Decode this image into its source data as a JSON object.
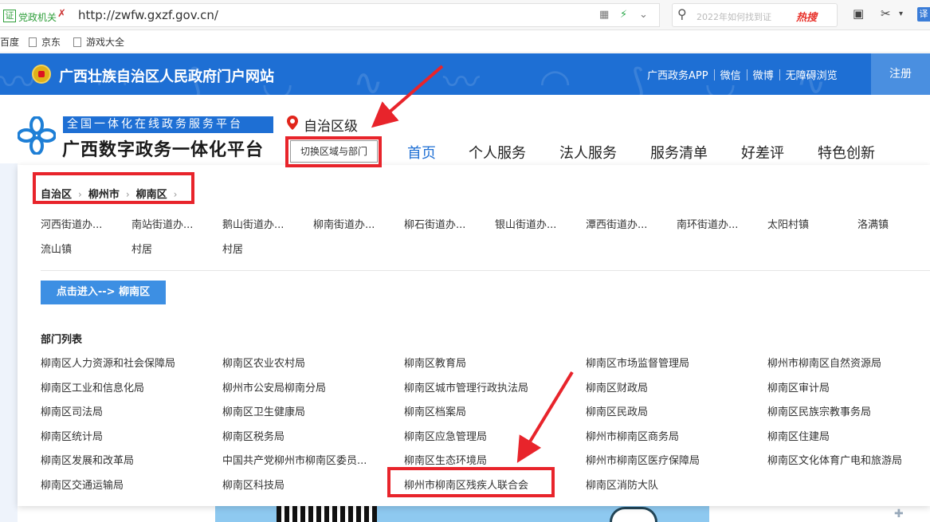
{
  "browser": {
    "cert_glyph": "证",
    "cert_label": "党政机关",
    "cert_mark": "✗",
    "url": "http://zwfw.gxzf.gov.cn/",
    "search_placeholder": "2022年如何找到证",
    "search_hot": "热搜",
    "translate_label": "译",
    "bookmarks": [
      "百度",
      "京东",
      "游戏大全"
    ]
  },
  "site": {
    "title": "广西壮族自治区人民政府门户网站",
    "links": [
      "广西政务APP",
      "微信",
      "微博",
      "无障碍浏览"
    ],
    "register": "注册",
    "brand_color": "#1e6fd4"
  },
  "platform": {
    "tagline": "全国一体化在线政务服务平台",
    "name": "广西数字政务一体化平台",
    "region": "自治区级",
    "switch_label": "切换区域与部门"
  },
  "nav": [
    "首页",
    "个人服务",
    "法人服务",
    "服务清单",
    "好差评",
    "特色创新"
  ],
  "panel": {
    "breadcrumb": [
      "自治区",
      "柳州市",
      "柳南区"
    ],
    "towns": [
      "河西街道办...",
      "南站街道办...",
      "鹅山街道办...",
      "柳南街道办...",
      "柳石街道办...",
      "银山街道办...",
      "潭西街道办...",
      "南环街道办...",
      "太阳村镇",
      "洛满镇",
      "流山镇",
      "村居",
      "村居"
    ],
    "enter_label": "点击进入--> 柳南区",
    "dept_title": "部门列表",
    "departments": [
      "柳南区人力资源和社会保障局",
      "柳南区农业农村局",
      "柳南区教育局",
      "柳南区市场监督管理局",
      "柳州市柳南区自然资源局",
      "柳南区工业和信息化局",
      "柳州市公安局柳南分局",
      "柳南区城市管理行政执法局",
      "柳南区财政局",
      "柳南区审计局",
      "柳南区司法局",
      "柳南区卫生健康局",
      "柳南区档案局",
      "柳南区民政局",
      "柳南区民族宗教事务局",
      "柳南区统计局",
      "柳南区税务局",
      "柳南区应急管理局",
      "柳州市柳南区商务局",
      "柳南区住建局",
      "柳南区发展和改革局",
      "中国共产党柳州市柳南区委员...",
      "柳南区生态环境局",
      "柳州市柳南区医疗保障局",
      "柳南区文化体育广电和旅游局",
      "柳南区交通运输局",
      "柳南区科技局",
      "柳州市柳南区残疾人联合会",
      "柳南区消防大队"
    ]
  },
  "annotation_color": "#e8242b"
}
